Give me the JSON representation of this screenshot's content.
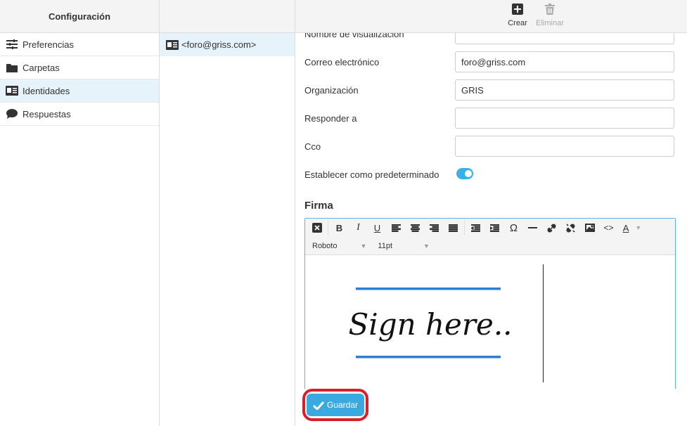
{
  "settings": {
    "title": "Configuración",
    "items": [
      {
        "label": "Preferencias",
        "icon": "sliders-icon"
      },
      {
        "label": "Carpetas",
        "icon": "folder-icon"
      },
      {
        "label": "Identidades",
        "icon": "id-card-icon",
        "active": true
      },
      {
        "label": "Respuestas",
        "icon": "comment-icon"
      }
    ]
  },
  "identities": {
    "items": [
      {
        "label": "<foro@griss.com>",
        "icon": "id-card-icon"
      }
    ]
  },
  "toolbar": {
    "create_label": "Crear",
    "delete_label": "Eliminar"
  },
  "form": {
    "display_name_label": "Nombre de visualización",
    "display_name_value": "",
    "email_label": "Correo electrónico",
    "email_value": "foro@griss.com",
    "organization_label": "Organización",
    "organization_value": "GRIS",
    "reply_to_label": "Responder a",
    "reply_to_value": "",
    "bcc_label": "Cco",
    "bcc_value": "",
    "default_label": "Establecer como predeterminado",
    "default_on": true
  },
  "signature": {
    "heading": "Firma",
    "font_family": "Roboto",
    "font_size": "11pt",
    "image_text": "Sign here.."
  },
  "actions": {
    "save_label": "Guardar"
  },
  "colors": {
    "accent": "#39a9e0",
    "highlight": "#d9202a",
    "active_bg": "#e6f3fa"
  }
}
